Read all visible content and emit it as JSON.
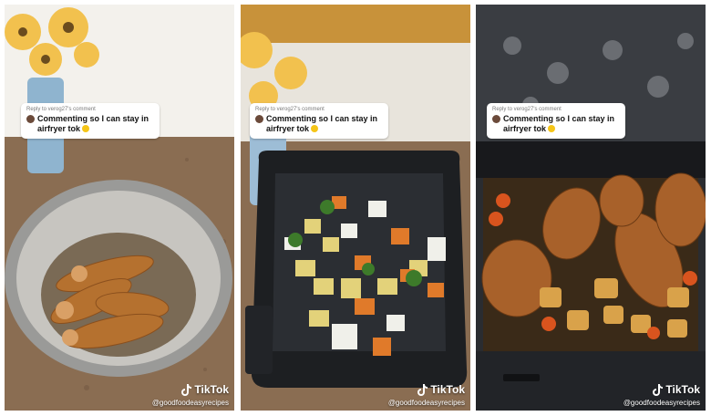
{
  "panels": [
    {
      "reply_label": "Reply to verog27's comment",
      "comment": "Commenting so I can stay in airfryer tok",
      "brand": "TikTok",
      "handle": "@goodfoodeasyrecipes"
    },
    {
      "reply_label": "Reply to verog27's comment",
      "comment": "Commenting so I can stay in airfryer tok",
      "brand": "TikTok",
      "handle": "@goodfoodeasyrecipes"
    },
    {
      "reply_label": "Reply to verog27's comment",
      "comment": "Commenting so I can stay in airfryer tok",
      "brand": "TikTok",
      "handle": "@goodfoodeasyrecipes"
    }
  ],
  "icons": {
    "logo": "tiktok-logo-icon",
    "emoji": "grinning-emoji-icon"
  },
  "colors": {
    "bubble_bg": "#ffffff",
    "text_dark": "#111111",
    "overlay_text": "#ffffff",
    "countertop": "#8a6d52"
  }
}
